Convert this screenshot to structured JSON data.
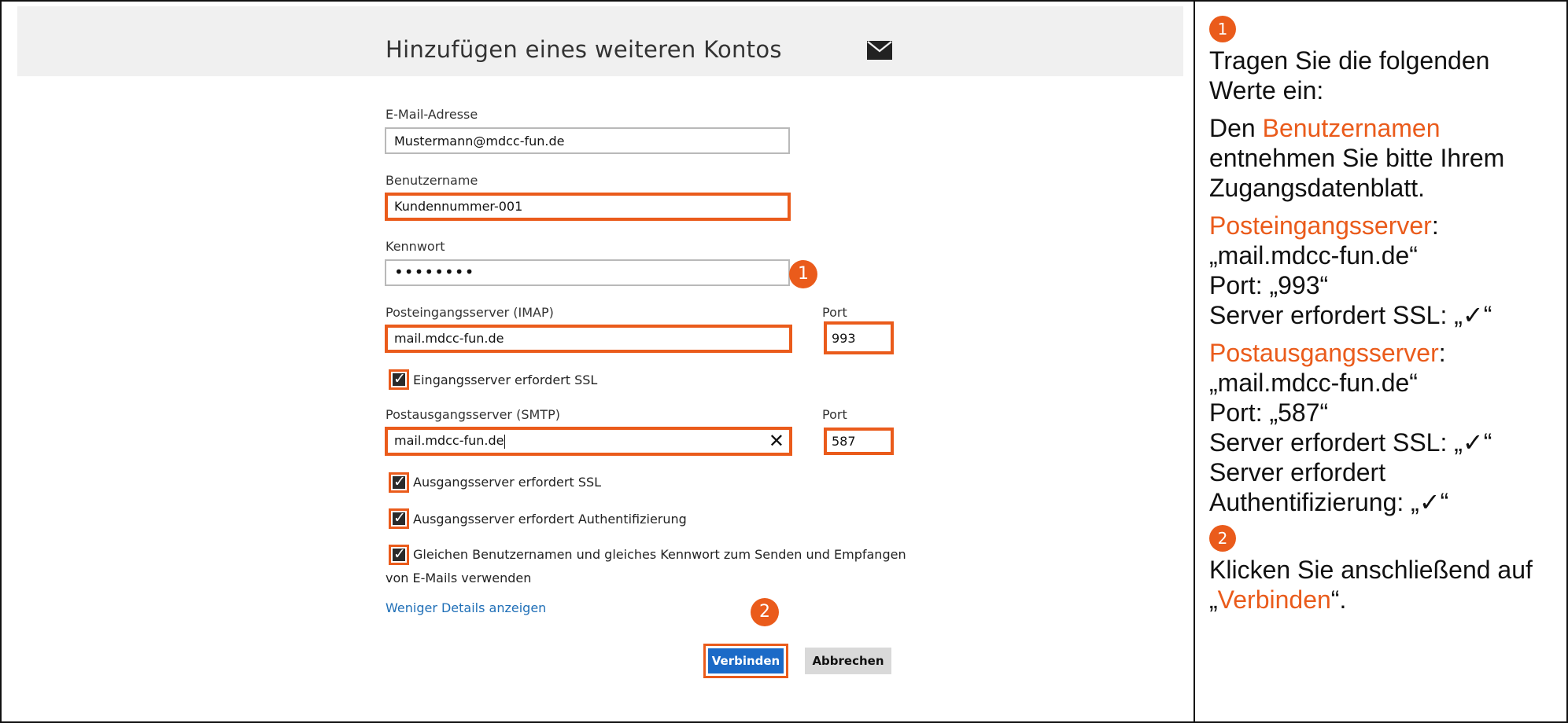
{
  "dialog": {
    "title": "Hinzufügen eines weiteren Kontos",
    "icon": "mail-icon"
  },
  "fields": {
    "email": {
      "label": "E-Mail-Adresse",
      "value": "Mustermann@mdcc-fun.de"
    },
    "username": {
      "label": "Benutzername",
      "value": "Kundennummer-001"
    },
    "password": {
      "label": "Kennwort",
      "value": "••••••••"
    },
    "incoming_server": {
      "label": "Posteingangsserver (IMAP)",
      "value": "mail.mdcc-fun.de"
    },
    "incoming_port": {
      "label": "Port",
      "value": "993"
    },
    "outgoing_server": {
      "label": "Postausgangsserver (SMTP)",
      "value": "mail.mdcc-fun.de"
    },
    "outgoing_port": {
      "label": "Port",
      "value": "587"
    }
  },
  "checkboxes": {
    "incoming_ssl": {
      "label": "Eingangsserver erfordert SSL",
      "checked": true
    },
    "outgoing_ssl": {
      "label": "Ausgangsserver erfordert SSL",
      "checked": true
    },
    "outgoing_auth": {
      "label": "Ausgangsserver erfordert Authentifizierung",
      "checked": true
    },
    "same_credentials": {
      "label_line1": "Gleichen Benutzernamen und gleiches Kennwort zum Senden und Empfangen",
      "label_line2": "von E-Mails verwenden",
      "checked": true
    }
  },
  "links": {
    "less_details": "Weniger Details anzeigen"
  },
  "buttons": {
    "connect": "Verbinden",
    "cancel": "Abbrechen"
  },
  "badges": {
    "one": "1",
    "two": "2"
  },
  "instructions": {
    "step1": {
      "intro": "Tragen Sie die folgenden Werte ein:",
      "username_prefix": "Den ",
      "username_term": "Benutzernamen",
      "username_suffix": " entnehmen Sie bitte Ihrem Zugangsdatenblatt.",
      "incoming_term": "Posteingangsserver",
      "incoming_colon": ":",
      "incoming_host": "„mail.mdcc-fun.de“",
      "incoming_port": "Port: „993“",
      "incoming_ssl": "Server erfordert SSL: „✓“",
      "outgoing_term": "Postausgangsserver",
      "outgoing_colon": ":",
      "outgoing_host": "„mail.mdcc-fun.de“",
      "outgoing_port": "Port: „587“",
      "outgoing_ssl": "Server erfordert SSL: „✓“",
      "outgoing_auth": "Server erfordert Authentifizierung: „✓“"
    },
    "step2": {
      "text_before": "Klicken Sie anschließend auf „",
      "term": "Verbinden",
      "text_after": "“."
    }
  },
  "colors": {
    "accent": "#ea5b1b",
    "link": "#1f6fb7",
    "primary_button": "#1b6ac7"
  }
}
